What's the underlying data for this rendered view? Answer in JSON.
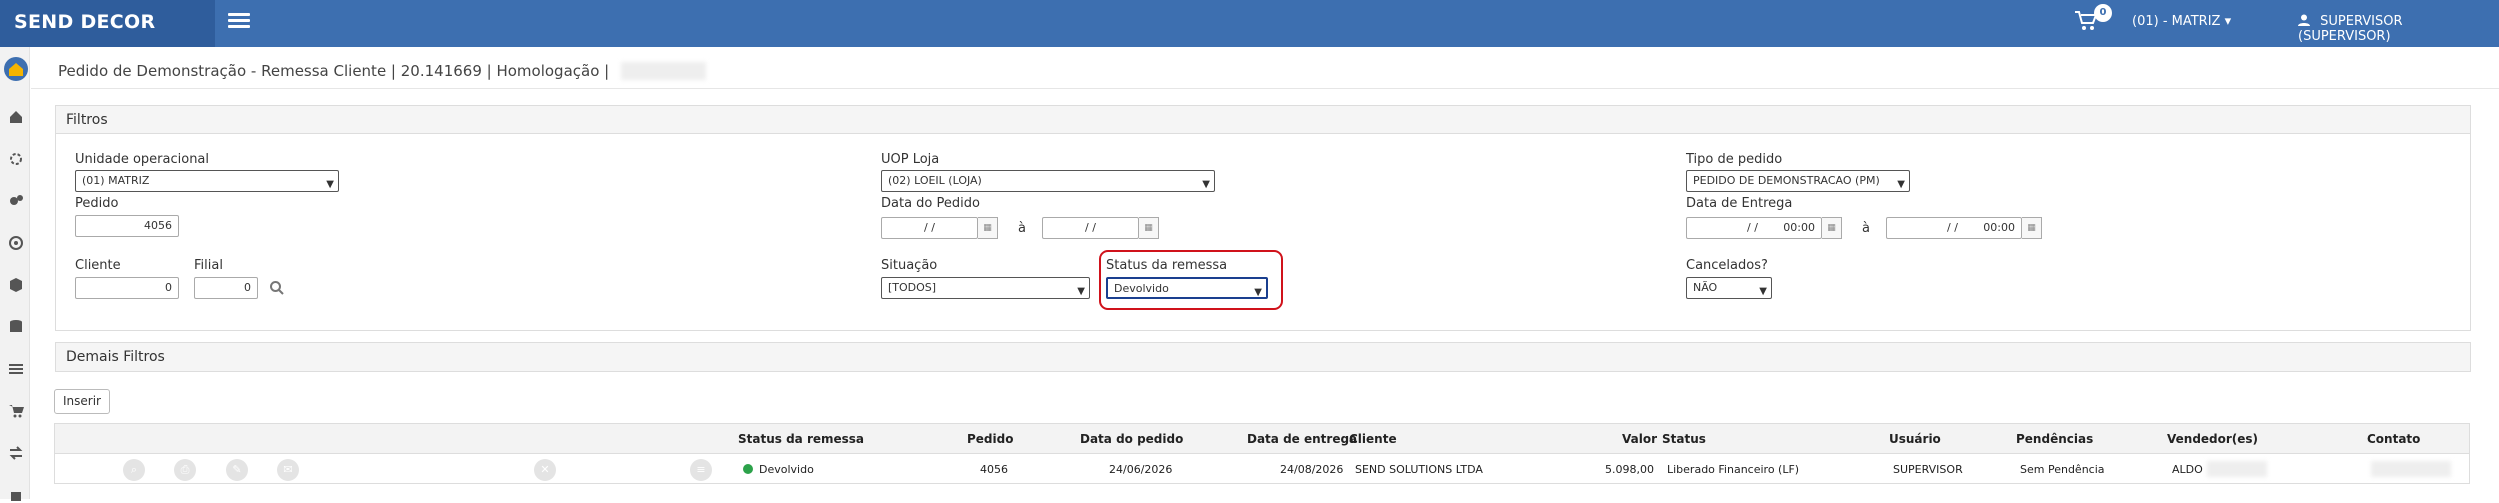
{
  "header": {
    "brand": "SEND DECOR",
    "cart_count": "0",
    "unit_selector": "(01) - MATRIZ ▾",
    "user": "SUPERVISOR (SUPERVISOR)"
  },
  "breadcrumb": "Pedido de Demonstração - Remessa Cliente | 20.141669 | Homologação |",
  "filters": {
    "title": "Filtros",
    "unidade_label": "Unidade operacional",
    "unidade_value": "(01)        MATRIZ",
    "uop_label": "UOP Loja",
    "uop_value": "(02) LOEIL        (LOJA)",
    "tipo_label": "Tipo de pedido",
    "tipo_value": "PEDIDO DE DEMONSTRACAO (PM)",
    "pedido_label": "Pedido",
    "pedido_value": "4056",
    "data_pedido_label": "Data do Pedido",
    "data_pedido_from": "/ /",
    "data_pedido_sep": "à",
    "data_pedido_to": "/ /",
    "data_entrega_label": "Data de Entrega",
    "data_entrega_from": "/ /",
    "data_entrega_from_time": "00:00",
    "data_entrega_sep": "à",
    "data_entrega_to": "/ /",
    "data_entrega_to_time": "00:00",
    "cliente_label": "Cliente",
    "cliente_value": "0",
    "filial_label": "Filial",
    "filial_value": "0",
    "situacao_label": "Situação",
    "situacao_value": "[TODOS]",
    "status_remessa_label": "Status da remessa",
    "status_remessa_value": "Devolvido",
    "cancelados_label": "Cancelados?",
    "cancelados_value": "NÃO"
  },
  "demais_filtros": "Demais Filtros",
  "inserir_button": "Inserir",
  "table": {
    "headers": {
      "status_remessa": "Status da remessa",
      "pedido": "Pedido",
      "data_pedido": "Data do pedido",
      "data_entrega": "Data de entrega",
      "cliente": "Cliente",
      "valor": "Valor",
      "status": "Status",
      "usuario": "Usuário",
      "pendencias": "Pendências",
      "vendedores": "Vendedor(es)",
      "contato": "Contato"
    },
    "rows": [
      {
        "status_remessa": "Devolvido",
        "pedido": "4056",
        "data_pedido": "24/06/2026",
        "data_entrega": "24/08/2026",
        "cliente": "SEND SOLUTIONS LTDA",
        "valor": "5.098,00",
        "status": "Liberado Financeiro (LF)",
        "usuario": "SUPERVISOR",
        "pendencias": "Sem Pendência",
        "vendedor": "ALDO"
      }
    ]
  },
  "colors": {
    "topbar": "#3d6fb0",
    "brand_bg": "#2f5d9c",
    "highlight": "#d0121b",
    "status_dot": "#2ca24a"
  }
}
